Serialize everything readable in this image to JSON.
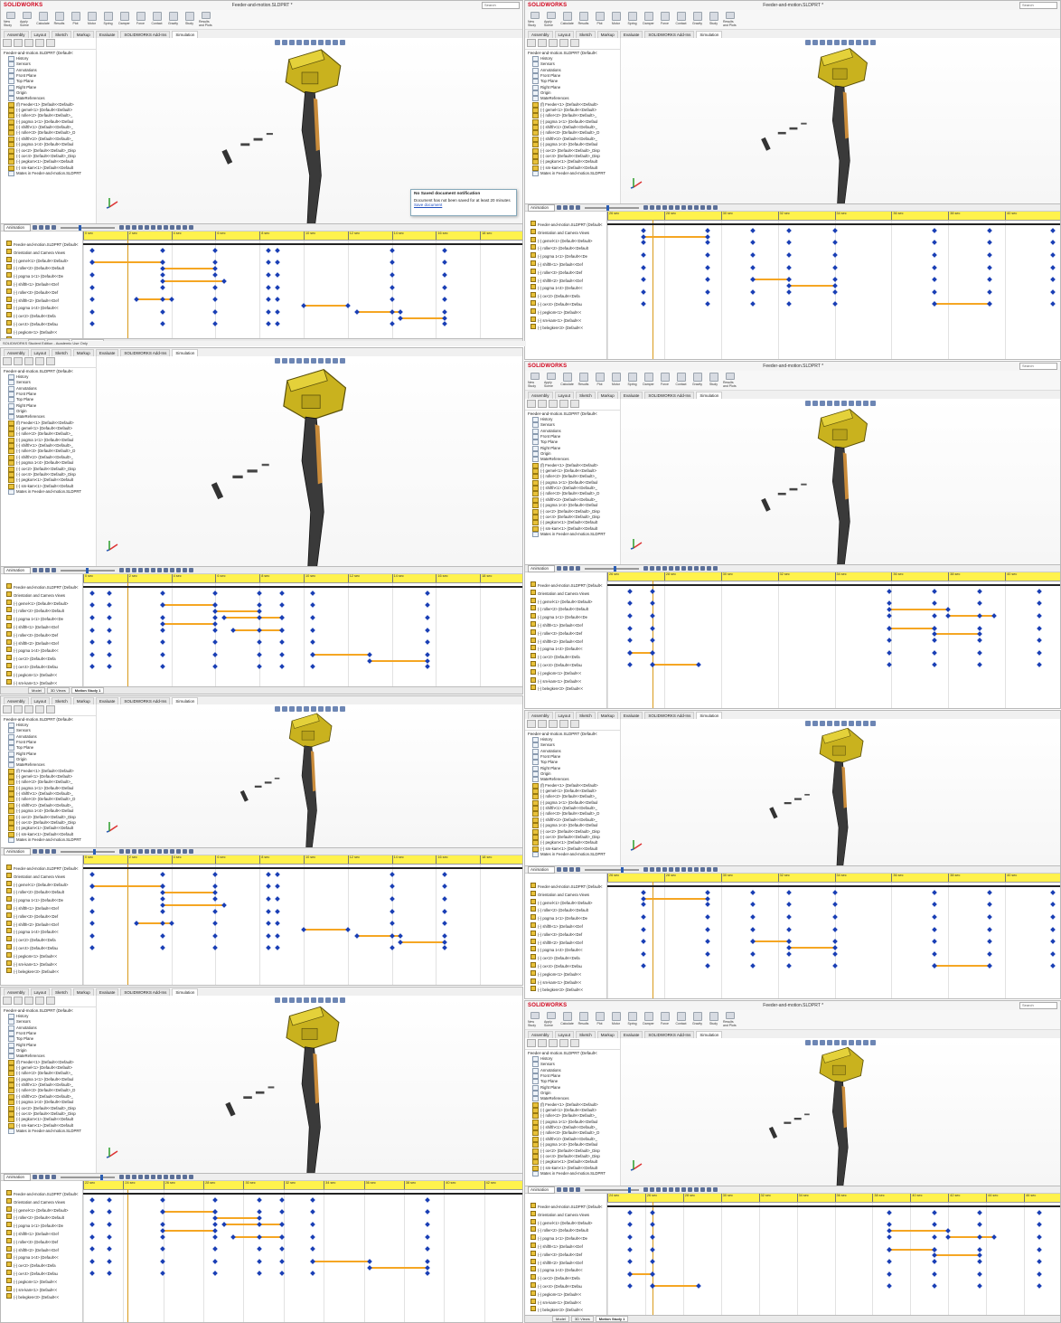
{
  "app": {
    "logo": "SOLIDWORKS",
    "doc_title": "Feeder-and-motion.SLDPRT *",
    "search_placeholder": "Search"
  },
  "ribbon": [
    "New Study",
    "Apply Scene",
    "Calculate",
    "Results",
    "Plot",
    "Motor",
    "Spring",
    "Damper",
    "Force",
    "Contact",
    "Gravity",
    "Study",
    "Results and Plots"
  ],
  "command_tabs": [
    "Assembly",
    "Layout",
    "Sketch",
    "Markup",
    "Evaluate",
    "SOLIDWORKS Add-Ins",
    "Simulation"
  ],
  "tree": {
    "root": "Feeder-and-motion.SLDPRT (Default<",
    "items": [
      {
        "label": "History",
        "kind": "plane"
      },
      {
        "label": "Sensors",
        "kind": "plane"
      },
      {
        "label": "Annotations",
        "kind": "plane"
      },
      {
        "label": "Front Plane",
        "kind": "plane"
      },
      {
        "label": "Top Plane",
        "kind": "plane"
      },
      {
        "label": "Right Plane",
        "kind": "plane"
      },
      {
        "label": "Origin",
        "kind": "plane"
      },
      {
        "label": "MateReferences",
        "kind": "plane"
      },
      {
        "label": "(f) Feeder<1> (Default<<Default>",
        "kind": "part"
      },
      {
        "label": "(-) gemel<1> (Default<<Default>",
        "kind": "part"
      },
      {
        "label": "(-) roller<2> (Default<<Default>_",
        "kind": "part"
      },
      {
        "label": "(-) pogma 1<1> (Default<<Defaul",
        "kind": "part"
      },
      {
        "label": "(-) shifth<1> (Default<<Default>_",
        "kind": "part"
      },
      {
        "label": "(-) roller<3> (Default<<Default>_D",
        "kind": "part"
      },
      {
        "label": "(-) shifth<2> (Default<<Default>_",
        "kind": "part"
      },
      {
        "label": "(-) pogma 1<4> (Default<<Defaul",
        "kind": "part"
      },
      {
        "label": "(-) ox<2> (Default<<Default>_Disp",
        "kind": "part"
      },
      {
        "label": "(-) ox<4> (Default<<Default>_Disp",
        "kind": "part"
      },
      {
        "label": "(-) pegkom<1> (Default<<Default",
        "kind": "part"
      },
      {
        "label": "(-) sm-kam<1> (Default<<Default",
        "kind": "part"
      },
      {
        "label": "Mates in Feeder-and-motion.SLDPRT",
        "kind": "plane"
      }
    ]
  },
  "motion_manager": {
    "study_type": "Animation",
    "bottom_tabs": [
      "Model",
      "3D Views",
      "Motion Study 1"
    ]
  },
  "timeline_tree": [
    "Feeder-and-motion.SLDPRT (Default<",
    "Orientation and Camera Views",
    "(-) gemel<1> (Default<<Default>",
    "(-) roller<2> (Default<<Default",
    "(-) pogma 1<1> (Default<<De",
    "(-) shifth<1> (Default<<Def",
    "(-) roller<3> (Default<<Def",
    "(-) shifth<2> (Default<<Def",
    "(-) pogma 1<4> (Default<<",
    "(-) ox<2> (Default<<Defa",
    "(-) ox<4> (Default<<Defau",
    "(-) pegkom<1> (Default<<",
    "(-) sm-kam<1> (Default<<",
    "(-) belegkes<3> (Default<<"
  ],
  "timeline_sets": {
    "a": [
      "0 sec",
      "2 sec",
      "4 sec",
      "6 sec",
      "8 sec",
      "10 sec",
      "12 sec",
      "14 sec",
      "16 sec",
      "18 sec"
    ],
    "b": [
      "26 sec",
      "28 sec",
      "30 sec",
      "32 sec",
      "34 sec",
      "36 sec",
      "38 sec",
      "40 sec"
    ],
    "c": [
      "34 sec",
      "36 sec",
      "38 sec",
      "40 sec",
      "42 sec",
      "44 sec",
      "46 sec"
    ],
    "d": [
      "22 sec",
      "24 sec",
      "26 sec",
      "28 sec",
      "30 sec",
      "32 sec",
      "34 sec",
      "36 sec",
      "38 sec",
      "40 sec",
      "42 sec"
    ],
    "e": [
      "24 sec",
      "26 sec",
      "28 sec",
      "30 sec",
      "32 sec",
      "34 sec",
      "36 sec",
      "38 sec",
      "40 sec",
      "42 sec",
      "44 sec",
      "46 sec"
    ]
  },
  "notification": {
    "title": "No Saved document notification",
    "body": "Document has not been saved for at least 20 minutes",
    "link": "Save document"
  },
  "status": "SOLIDWORKS Student Edition - Academic Use Only",
  "colors": {
    "part_yellow": "#c9b21e",
    "key_blue": "#1a3fb5",
    "segment_orange": "#f5a623",
    "ruler_yellow": "#fff24d"
  }
}
